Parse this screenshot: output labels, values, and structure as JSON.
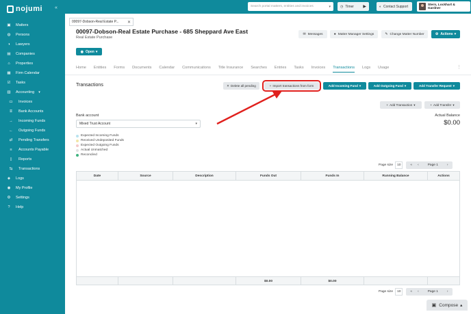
{
  "app": {
    "logo": "nojumi"
  },
  "sidebar": {
    "items": [
      {
        "label": "Matters",
        "icon": "briefcase-icon"
      },
      {
        "label": "Persons",
        "icon": "persons-icon"
      },
      {
        "label": "Lawyers",
        "icon": "lawyer-icon"
      },
      {
        "label": "Companies",
        "icon": "building-icon"
      },
      {
        "label": "Properties",
        "icon": "home-icon"
      },
      {
        "label": "Firm Calendar",
        "icon": "calendar-icon"
      },
      {
        "label": "Tasks",
        "icon": "tasks-icon"
      },
      {
        "label": "Accounting",
        "icon": "accounting-icon"
      },
      {
        "label": "Invoices",
        "icon": "invoice-icon"
      },
      {
        "label": "Bank Accounts",
        "icon": "bank-icon"
      },
      {
        "label": "Incoming Funds",
        "icon": "arrow-right-icon"
      },
      {
        "label": "Outgoing Funds",
        "icon": "arrow-left-icon"
      },
      {
        "label": "Pending Transfers",
        "icon": "transfer-icon"
      },
      {
        "label": "Accounts Payable",
        "icon": "payable-icon"
      },
      {
        "label": "Reports",
        "icon": "reports-icon"
      },
      {
        "label": "Transactions",
        "icon": "transactions-icon"
      },
      {
        "label": "Logs",
        "icon": "logs-icon"
      },
      {
        "label": "My Profile",
        "icon": "profile-icon"
      },
      {
        "label": "Settings",
        "icon": "gear-icon"
      },
      {
        "label": "Help",
        "icon": "help-icon"
      }
    ]
  },
  "topbar": {
    "search_placeholder": "Search portal matters, entities and invoices",
    "timer_label": "Timer",
    "support_label": "Contact Support",
    "firm_name": "Stern, Lockhart & Gardner"
  },
  "matter": {
    "tab_label": "00097-Dobson-Real Estate P...",
    "title": "00097-Dobson-Real Estate Purchase - 685 Sheppard Ave East",
    "subtitle": "Real Estate Purchase",
    "messages_label": "Messages",
    "manager_settings_label": "Matter Manager Settings",
    "change_number_label": "Change Matter Number",
    "actions_label": "Actions",
    "status_label": "Open"
  },
  "tabs": [
    "Home",
    "Entities",
    "Forms",
    "Documents",
    "Calendar",
    "Communications",
    "Title Insurance",
    "Searches",
    "Entries",
    "Tasks",
    "Invoices",
    "Transactions",
    "Logs",
    "Usage"
  ],
  "transactions": {
    "title": "Transactions",
    "delete_pending_label": "Delete all pending",
    "import_label": "Import transactions from form",
    "add_incoming_label": "Add Incoming Fund",
    "add_outgoing_label": "Add Outgoing Fund",
    "add_transfer_request_label": "Add Transfer Request",
    "add_transaction_label": "Add Transaction",
    "add_transfer_label": "Add Transfer",
    "bank_account_label": "Bank account",
    "bank_account_value": "Mixed Trust Account",
    "actual_balance_label": "Actual Balance",
    "actual_balance_value": "$0.00",
    "legend": [
      {
        "label": "Expected Incoming Funds",
        "color": "#b9e3ef"
      },
      {
        "label": "Received Undeposited Funds",
        "color": "#f2e6a6"
      },
      {
        "label": "Expected Outgoing Funds",
        "color": "#f3c9c9"
      },
      {
        "label": "Actual Unmatched",
        "color": "#e2e2e2"
      },
      {
        "label": "Reconciled",
        "color": "#3fb37f"
      }
    ],
    "page_size_label": "Page size",
    "page_size_value": "10",
    "page_label": "Page 1",
    "columns": [
      "Date",
      "Source",
      "Description",
      "Funds Out",
      "Funds In",
      "Running Balance",
      "Actions"
    ],
    "totals": {
      "funds_out": "$0.00",
      "funds_in": "$0.00"
    }
  },
  "compose_label": "Compose",
  "colors": {
    "brand": "#0f8a9c",
    "highlight": "#e0201d"
  }
}
